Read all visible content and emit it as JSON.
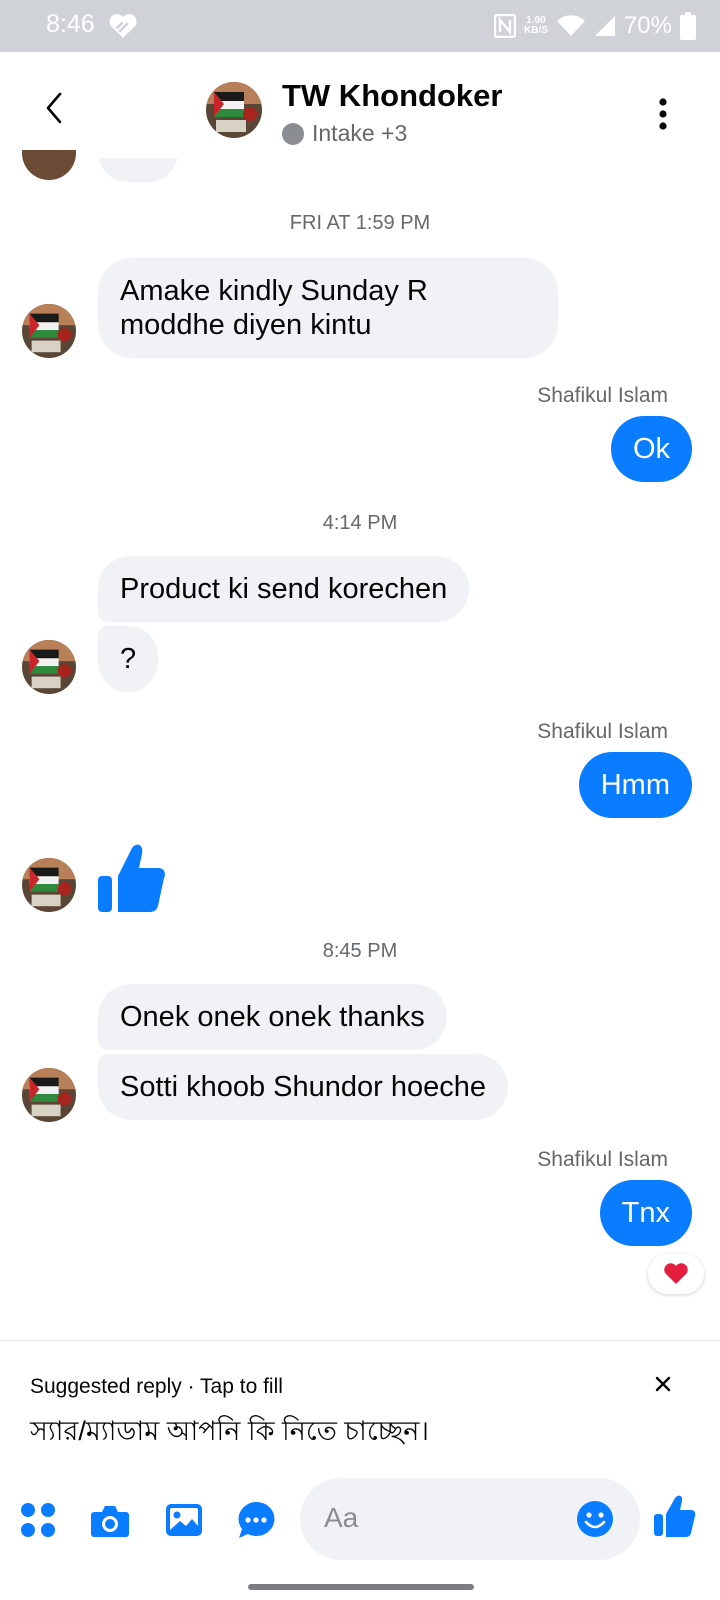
{
  "status_bar": {
    "time": "8:46",
    "net_speed_top": "1.00",
    "net_speed_bottom": "KB/S",
    "battery": "70%"
  },
  "header": {
    "name": "TW Khondoker",
    "subtitle": "Intake +3"
  },
  "messages": {
    "ts1": "FRI AT 1:59 PM",
    "m1": "Amake kindly Sunday R moddhe diyen kintu",
    "sender1": "Shafikul Islam",
    "out1": "Ok",
    "ts2": "4:14 PM",
    "m2": "Product ki send korechen",
    "m3": "?",
    "sender2": "Shafikul Islam",
    "out2": "Hmm",
    "ts3": "8:45 PM",
    "m4": "Onek onek onek thanks",
    "m5": "Sotti khoob Shundor hoeche",
    "sender3": "Shafikul Islam",
    "out3": "Tnx"
  },
  "suggested_reply": {
    "header": "Suggested reply · Tap to fill",
    "text": "স্যার/ম্যাডাম আপনি কি নিতে চাচ্ছেন।"
  },
  "composer": {
    "placeholder": "Aa"
  },
  "colors": {
    "accent": "#0a7cff",
    "incoming_bubble": "#f0f2f5"
  }
}
